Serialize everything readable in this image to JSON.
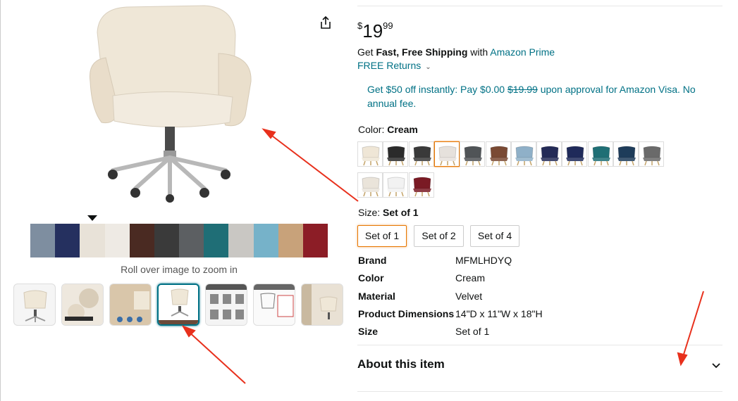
{
  "price": {
    "symbol": "$",
    "whole": "19",
    "fraction": "99"
  },
  "shipping": {
    "prefix": "Get ",
    "bold": "Fast, Free Shipping",
    "middle": " with ",
    "link": "Amazon Prime"
  },
  "returns": {
    "label": "FREE Returns"
  },
  "promo": {
    "before": "Get $50 off instantly: Pay $0.00 ",
    "strike": "$19.99",
    "after": " upon approval for Amazon Visa. No annual fee."
  },
  "color_selector": {
    "label": "Color: ",
    "selected": "Cream",
    "options": [
      {
        "name": "cream",
        "color": "#efe6d6"
      },
      {
        "name": "black",
        "color": "#2b2b2b"
      },
      {
        "name": "black-velvet",
        "color": "#3a3a3a"
      },
      {
        "name": "white-gray",
        "color": "#e6e1dc"
      },
      {
        "name": "dark-gray",
        "color": "#505457"
      },
      {
        "name": "brown",
        "color": "#7a4a34"
      },
      {
        "name": "light-blue",
        "color": "#8fb0c8"
      },
      {
        "name": "navy-a",
        "color": "#242b57"
      },
      {
        "name": "navy-b",
        "color": "#1f2a5a"
      },
      {
        "name": "teal",
        "color": "#1f6f75"
      },
      {
        "name": "dark-teal",
        "color": "#1e3c5a"
      },
      {
        "name": "gray",
        "color": "#6a6a6a"
      },
      {
        "name": "beige-light",
        "color": "#eae4da"
      },
      {
        "name": "white",
        "color": "#f2f2f2"
      },
      {
        "name": "burgundy",
        "color": "#7a1a24"
      }
    ]
  },
  "size_selector": {
    "label": "Size: ",
    "selected": "Set of 1",
    "options": [
      "Set of 1",
      "Set of 2",
      "Set of 4"
    ]
  },
  "gallery": {
    "zoom_hint": "Roll over image to zoom in",
    "strip_colors": [
      "#7e8ea0",
      "#25305f",
      "#e8e2d8",
      "#eeeae4",
      "#4a2a22",
      "#3a3a3a",
      "#5c5f62",
      "#1f6e76",
      "#c9c7c3",
      "#76b2c9",
      "#c8a27a",
      "#8c1d26"
    ],
    "thumbnails": [
      "chair-front",
      "velvet-fabric-detail",
      "chair-lifestyle",
      "chair-with-swatches",
      "assembly-steps",
      "measurement-guide",
      "chair-in-room"
    ]
  },
  "specs": [
    {
      "key": "Brand",
      "value": "MFMLHDYQ"
    },
    {
      "key": "Color",
      "value": "Cream"
    },
    {
      "key": "Material",
      "value": "Velvet"
    },
    {
      "key": "Product Dimensions",
      "value": "14\"D x 11\"W x 18\"H"
    },
    {
      "key": "Size",
      "value": "Set of 1"
    }
  ],
  "about": {
    "label": "About this item"
  },
  "theme": {
    "link": "#007185",
    "selected": "#e77600",
    "annotation_arrow": "#e8301c"
  }
}
